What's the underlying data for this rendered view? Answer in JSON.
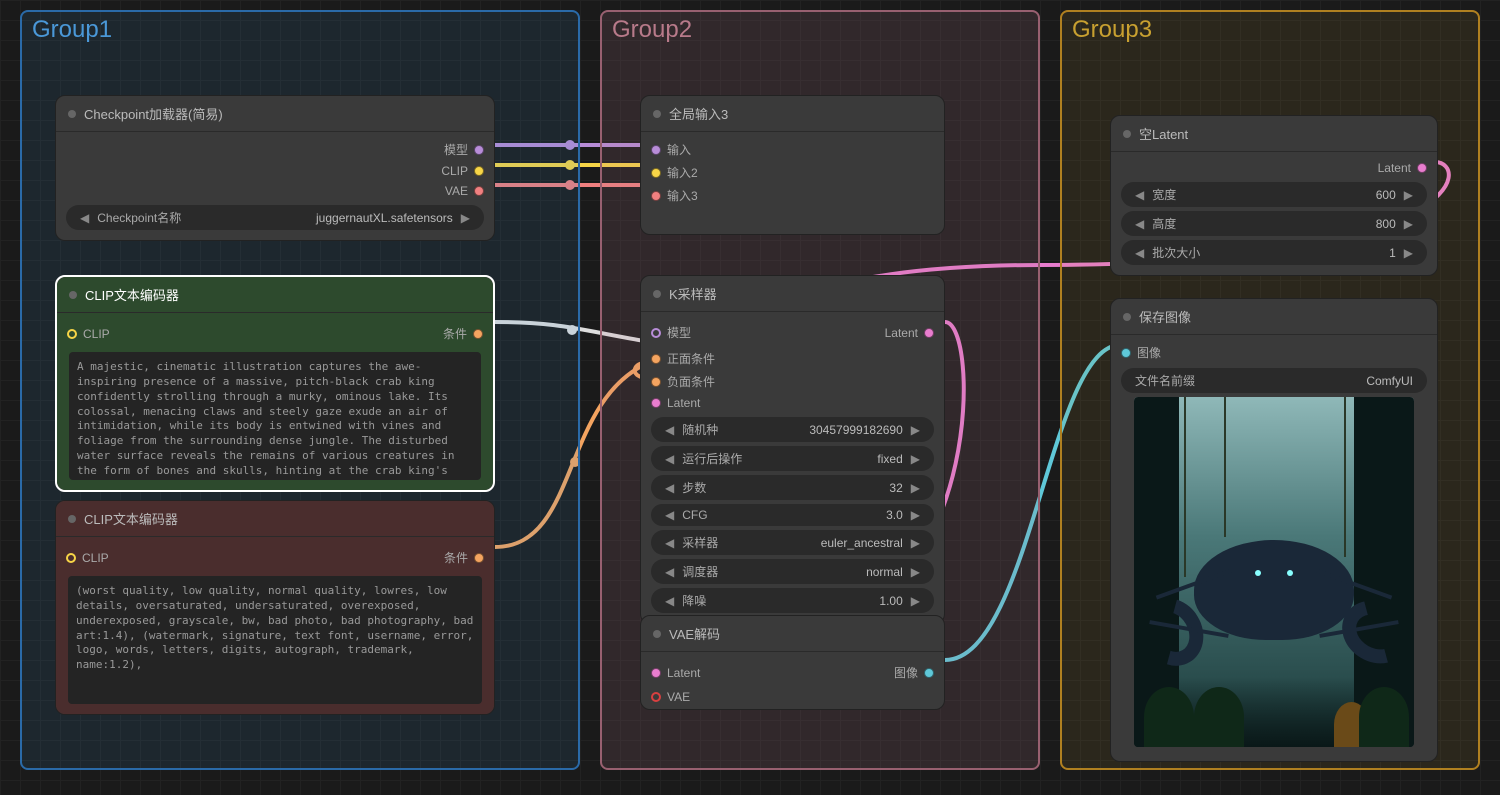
{
  "groups": {
    "g1": {
      "title": "Group1",
      "color": "#3a88c8"
    },
    "g2": {
      "title": "Group2",
      "color": "#b87a8a"
    },
    "g3": {
      "title": "Group3",
      "color": "#c8a030"
    }
  },
  "nodes": {
    "checkpoint": {
      "title": "Checkpoint加载器(简易)",
      "outputs": {
        "model": "模型",
        "clip": "CLIP",
        "vae": "VAE"
      },
      "widget_label": "Checkpoint名称",
      "widget_value": "juggernautXL.safetensors"
    },
    "clip_pos": {
      "title": "CLIP文本编码器",
      "input": "CLIP",
      "output": "条件",
      "text": "A majestic, cinematic illustration captures the awe-inspiring presence of a massive, pitch-black crab king confidently strolling through a murky, ominous lake. Its colossal, menacing claws and steely gaze exude an air of intimidation, while its body is entwined with vines and foliage from the surrounding dense jungle. The disturbed water surface reveals the remains of various creatures in the form of bones and skulls, hinting at the crab king's ferocity. The foggy background, with its mysterious and eerie atmosphere, contrasts with the vibrant colors and intricate details of the scene, creating a mesmerizing visual experience."
    },
    "clip_neg": {
      "title": "CLIP文本编码器",
      "input": "CLIP",
      "output": "条件",
      "text": "(worst quality, low quality, normal quality, lowres, low details, oversaturated, undersaturated, overexposed, underexposed, grayscale, bw, bad photo, bad photography, bad art:1.4), (watermark, signature, text font, username, error, logo, words, letters, digits, autograph, trademark, name:1.2),"
    },
    "global_input": {
      "title": "全局输入3",
      "inputs": {
        "i1": "输入",
        "i2": "输入2",
        "i3": "输入3"
      }
    },
    "ksampler": {
      "title": "K采样器",
      "inputs": {
        "model": "模型",
        "pos": "正面条件",
        "neg": "负面条件",
        "latent": "Latent"
      },
      "output": "Latent",
      "widgets": [
        {
          "label": "随机种",
          "value": "30457999182690"
        },
        {
          "label": "运行后操作",
          "value": "fixed"
        },
        {
          "label": "步数",
          "value": "32"
        },
        {
          "label": "CFG",
          "value": "3.0"
        },
        {
          "label": "采样器",
          "value": "euler_ancestral"
        },
        {
          "label": "调度器",
          "value": "normal"
        },
        {
          "label": "降噪",
          "value": "1.00"
        }
      ]
    },
    "vae_decode": {
      "title": "VAE解码",
      "inputs": {
        "latent": "Latent",
        "vae": "VAE"
      },
      "output": "图像"
    },
    "empty_latent": {
      "title": "空Latent",
      "output": "Latent",
      "widgets": [
        {
          "label": "宽度",
          "value": "600"
        },
        {
          "label": "高度",
          "value": "800"
        },
        {
          "label": "批次大小",
          "value": "1"
        }
      ]
    },
    "save_image": {
      "title": "保存图像",
      "input": "图像",
      "widget_label": "文件名前缀",
      "widget_value": "ComfyUI"
    }
  }
}
